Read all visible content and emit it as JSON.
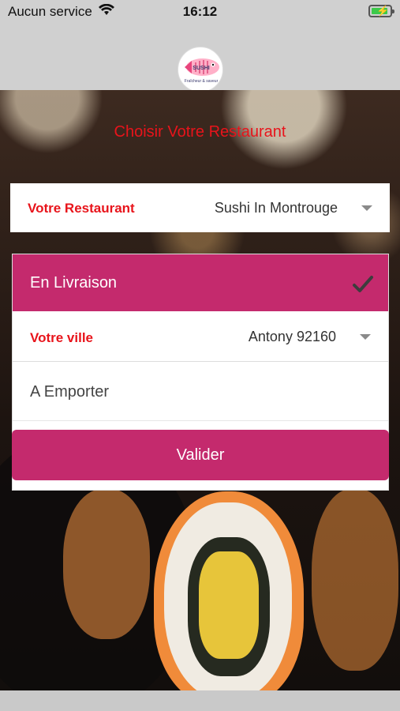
{
  "status_bar": {
    "carrier": "Aucun service",
    "time": "16:12",
    "wifi_icon": "wifi-icon",
    "battery_icon": "battery-charging-icon"
  },
  "header": {
    "logo_name": "sushi-restaurant-logo",
    "logo_text": "SUSHI",
    "logo_subtext": "Fraîcheur & saveur"
  },
  "title": "Choisir Votre Restaurant",
  "restaurant_selector": {
    "label": "Votre Restaurant",
    "value": "Sushi In Montrouge",
    "icon": "chevron-down-icon"
  },
  "delivery_options": {
    "selected": {
      "label": "En Livraison",
      "icon": "checkmark-icon"
    },
    "city": {
      "label": "Votre ville",
      "value": "Antony 92160",
      "icon": "chevron-down-icon"
    },
    "takeaway": {
      "label": "A Emporter"
    }
  },
  "submit_button": {
    "label": "Valider"
  },
  "colors": {
    "accent": "#c42a6d",
    "label_red": "#e8141b",
    "status_gray": "#d0d0d0"
  }
}
